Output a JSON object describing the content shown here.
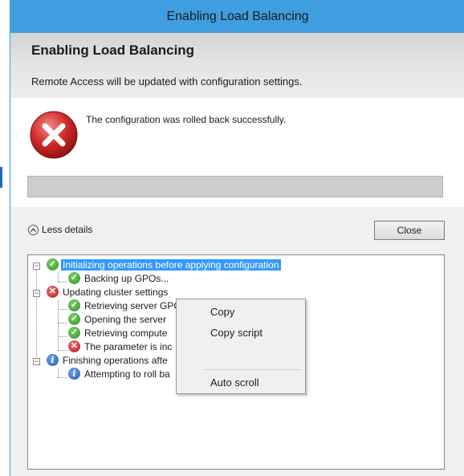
{
  "window": {
    "title": "Enabling Load Balancing"
  },
  "header": {
    "title": "Enabling Load Balancing",
    "description": "Remote Access will be updated with configuration settings."
  },
  "status": {
    "message": "The configuration was rolled back successfully.",
    "icon": "error-icon",
    "progress": 0
  },
  "controls": {
    "less_details": "Less details",
    "close": "Close"
  },
  "tree": {
    "items": [
      {
        "label": "Initializing operations before applying configuration",
        "status": "ok",
        "selected": true
      },
      {
        "label": "Backing up GPOs...",
        "status": "ok"
      },
      {
        "label": "Updating cluster settings",
        "status": "error"
      },
      {
        "label": "Retrieving server GPO details...",
        "status": "ok"
      },
      {
        "label": "Opening the server",
        "status": "ok"
      },
      {
        "label": "Retrieving compute",
        "status": "ok"
      },
      {
        "label": "The parameter is inc",
        "status": "error"
      },
      {
        "label": "Finishing operations afte",
        "status": "info"
      },
      {
        "label": "Attempting to roll ba",
        "status": "info"
      }
    ]
  },
  "context_menu": {
    "copy": "Copy",
    "copy_script": "Copy script",
    "auto_scroll": "Auto scroll"
  },
  "colors": {
    "titlebar": "#3e9ee0",
    "selection": "#3399ff",
    "success": "#2f8f1f",
    "error": "#b51c1c",
    "info": "#1f56b5"
  }
}
